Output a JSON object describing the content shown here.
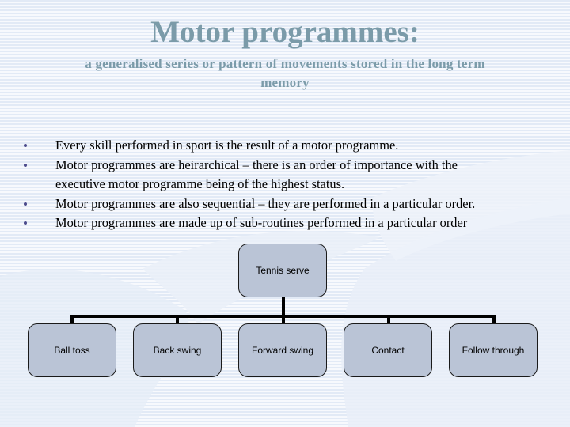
{
  "slide": {
    "title": "Motor programmes:",
    "subtitle_line1": "a generalised series or pattern of movements stored in the long term",
    "subtitle_line2": "memory",
    "bullets": [
      {
        "line1": "Every skill performed in sport is the result of a motor programme."
      },
      {
        "line1": "Motor programmes are heirarchical – there is an order of importance with the",
        "line2": "executive motor programme being of the highest status."
      },
      {
        "line1": "Motor programmes are also sequential – they are performed in a particular order."
      },
      {
        "line1": "Motor programmes are made up of sub-routines performed in a particular order"
      }
    ]
  },
  "diagram": {
    "root": {
      "label": "Tennis serve"
    },
    "children": [
      {
        "label": "Ball toss"
      },
      {
        "label": "Back swing"
      },
      {
        "label": "Forward swing"
      },
      {
        "label": "Contact"
      },
      {
        "label": "Follow through"
      }
    ]
  },
  "colors": {
    "title": "#7b9ba9",
    "node_fill": "#bac4d6",
    "bullet": "#4b4b8c",
    "stripe_blue": "#e2eaf6"
  }
}
